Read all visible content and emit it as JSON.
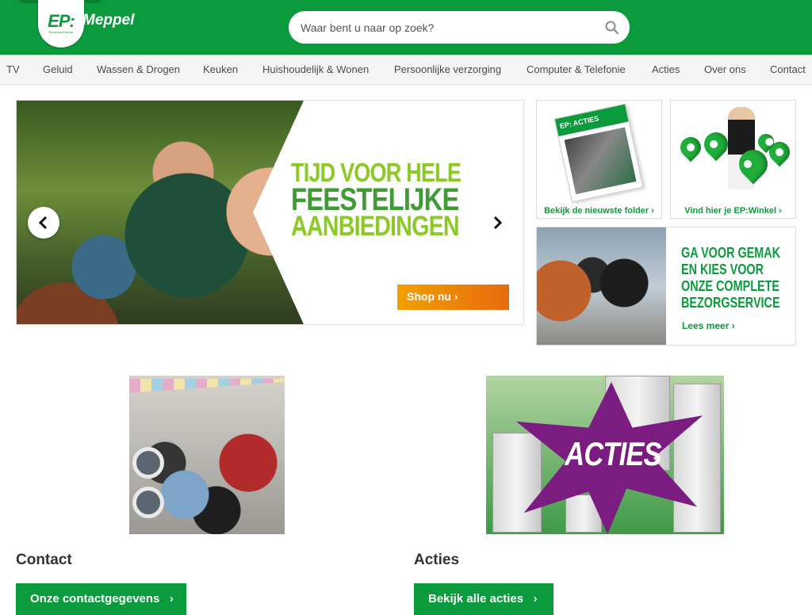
{
  "header": {
    "logo_text": "EP:",
    "logo_subtext": "ElectronicPartner",
    "store_name": "Meppel",
    "search_placeholder": "Waar bent u naar op zoek?"
  },
  "nav": {
    "items": [
      {
        "label": "TV"
      },
      {
        "label": "Geluid"
      },
      {
        "label": "Wassen & Drogen"
      },
      {
        "label": "Keuken"
      },
      {
        "label": "Huishoudelijk & Wonen"
      },
      {
        "label": "Persoonlijke verzorging"
      },
      {
        "label": "Computer & Telefonie"
      },
      {
        "label": "Acties"
      },
      {
        "label": "Over ons"
      },
      {
        "label": "Contact"
      }
    ]
  },
  "hero": {
    "line1": "TIJD VOOR HELE",
    "line2": "FEESTELIJKE",
    "line3": "AANBIEDINGEN",
    "cta": "Shop nu"
  },
  "tiles": {
    "folder_caption": "Bekijk de nieuwste folder",
    "folder_header": "EP: ACTIES",
    "store_caption": "Vind hier je EP:Winkel",
    "delivery_line1": "GA VOOR GEMAK",
    "delivery_line2": "EN KIES VOOR",
    "delivery_line3": "ONZE COMPLETE",
    "delivery_line4": "BEZORGSERVICE",
    "delivery_link": "Lees meer"
  },
  "sections": {
    "contact_title": "Contact",
    "contact_button": "Onze contactgegevens",
    "acties_title": "Acties",
    "acties_image_text": "ACTIES",
    "acties_button": "Bekijk alle acties"
  },
  "colors": {
    "brand_green": "#0b9a3c",
    "accent_orange": "#e86b10",
    "acties_purple": "#7b1d80"
  }
}
